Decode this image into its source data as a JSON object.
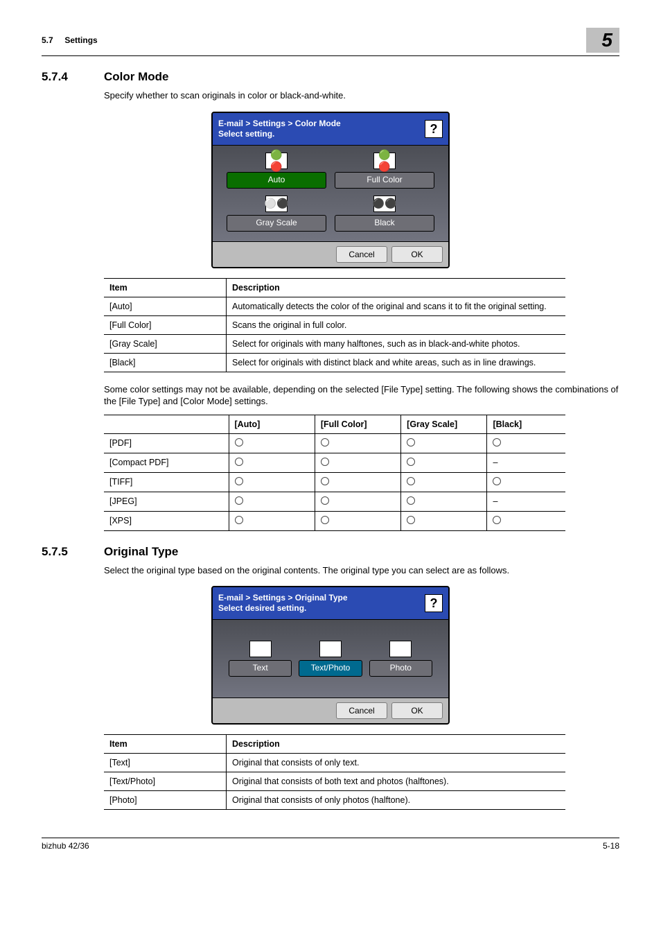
{
  "header": {
    "section_num": "5.7",
    "section_title": "Settings",
    "chapter": "5"
  },
  "s574": {
    "num": "5.7.4",
    "title": "Color Mode",
    "intro": "Specify whether to scan originals in color or black-and-white.",
    "ss": {
      "crumbs_line1": "E-mail > Settings > Color Mode",
      "crumbs_line2": "Select setting.",
      "help": "?",
      "auto": "Auto",
      "fullcolor": "Full Color",
      "grayscale": "Gray Scale",
      "black": "Black",
      "cancel": "Cancel",
      "ok": "OK"
    },
    "tbl_hdr_item": "Item",
    "tbl_hdr_desc": "Description",
    "rows": [
      {
        "item": "[Auto]",
        "desc": "Automatically detects the color of the original and scans it to fit the original setting."
      },
      {
        "item": "[Full Color]",
        "desc": "Scans the original in full color."
      },
      {
        "item": "[Gray Scale]",
        "desc": "Select for originals with many halftones, such as in black-and-white photos."
      },
      {
        "item": "[Black]",
        "desc": "Select for originals with distinct black and white areas, such as in line drawings."
      }
    ],
    "note": "Some color settings may not be available, depending on the selected [File Type] setting. The following shows the combinations of the [File Type] and [Color Mode] settings.",
    "t2_headers": {
      "auto": "[Auto]",
      "full": "[Full Color]",
      "gray": "[Gray Scale]",
      "black": "[Black]"
    },
    "t2_rows": [
      {
        "ft": "[PDF]",
        "auto": "o",
        "full": "o",
        "gray": "o",
        "black": "o"
      },
      {
        "ft": "[Compact PDF]",
        "auto": "o",
        "full": "o",
        "gray": "o",
        "black": "–"
      },
      {
        "ft": "[TIFF]",
        "auto": "o",
        "full": "o",
        "gray": "o",
        "black": "o"
      },
      {
        "ft": "[JPEG]",
        "auto": "o",
        "full": "o",
        "gray": "o",
        "black": "–"
      },
      {
        "ft": "[XPS]",
        "auto": "o",
        "full": "o",
        "gray": "o",
        "black": "o"
      }
    ]
  },
  "s575": {
    "num": "5.7.5",
    "title": "Original Type",
    "intro": "Select the original type based on the original contents. The original type you can select are as follows.",
    "ss": {
      "crumbs_line1": "E-mail > Settings > Original Type",
      "crumbs_line2": "Select desired setting.",
      "help": "?",
      "text": "Text",
      "textphoto": "Text/Photo",
      "photo": "Photo",
      "cancel": "Cancel",
      "ok": "OK"
    },
    "tbl_hdr_item": "Item",
    "tbl_hdr_desc": "Description",
    "rows": [
      {
        "item": "[Text]",
        "desc": "Original that consists of only text."
      },
      {
        "item": "[Text/Photo]",
        "desc": "Original that consists of both text and photos (halftones)."
      },
      {
        "item": "[Photo]",
        "desc": "Original that consists of only photos (halftone)."
      }
    ]
  },
  "footer": {
    "left": "bizhub 42/36",
    "right": "5-18"
  }
}
